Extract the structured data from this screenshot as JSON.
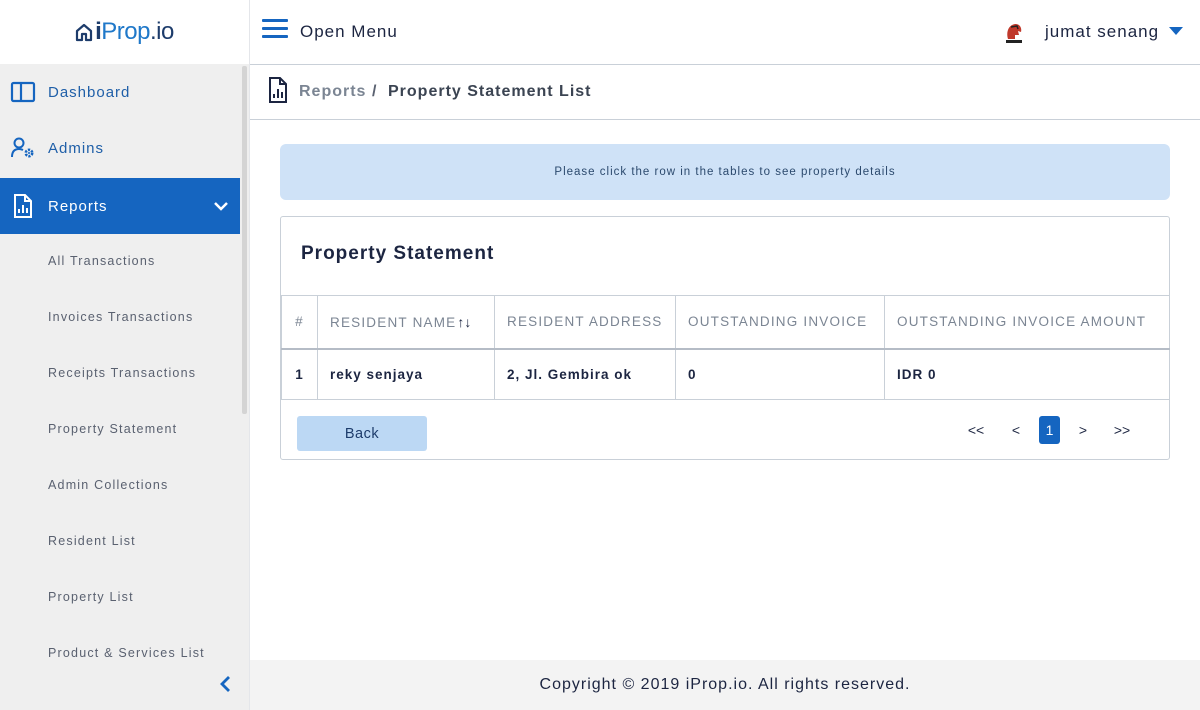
{
  "brand": {
    "logo_part1": "i",
    "logo_part2": "Prop",
    "logo_part3": ".io"
  },
  "header": {
    "menu_label": "Open Menu",
    "user_name": "jumat senang"
  },
  "sidebar": {
    "items": [
      {
        "label": "Dashboard"
      },
      {
        "label": "Admins"
      },
      {
        "label": "Reports"
      }
    ],
    "subitems": [
      {
        "label": "All Transactions"
      },
      {
        "label": "Invoices Transactions"
      },
      {
        "label": "Receipts Transactions"
      },
      {
        "label": "Property Statement"
      },
      {
        "label": "Admin Collections"
      },
      {
        "label": "Resident List"
      },
      {
        "label": "Property List"
      },
      {
        "label": "Product & Services List"
      }
    ]
  },
  "breadcrumb": {
    "root": "Reports",
    "separator": "/",
    "current": "Property Statement List"
  },
  "alert": {
    "text": "Please click the row in the tables to see property details"
  },
  "card": {
    "title": "Property Statement",
    "columns": [
      "#",
      "RESIDENT NAME",
      "RESIDENT ADDRESS",
      "OUTSTANDING INVOICE",
      "OUTSTANDING INVOICE AMOUNT"
    ],
    "sort_icon": "↑↓",
    "rows": [
      [
        "1",
        "reky senjaya",
        "2, Jl. Gembira ok",
        "0",
        "IDR 0"
      ]
    ],
    "back_label": "Back",
    "pagination": {
      "first": "<<",
      "prev": "<",
      "current": "1",
      "next": ">",
      "last": ">>"
    }
  },
  "footer": {
    "text": "Copyright © 2019 iProp.io. All rights reserved."
  },
  "colors": {
    "accent": "#1565c0",
    "alert_bg": "#cfe2f7",
    "sidebar_bg": "#efefef",
    "back_button_bg": "#bcd8f4"
  }
}
